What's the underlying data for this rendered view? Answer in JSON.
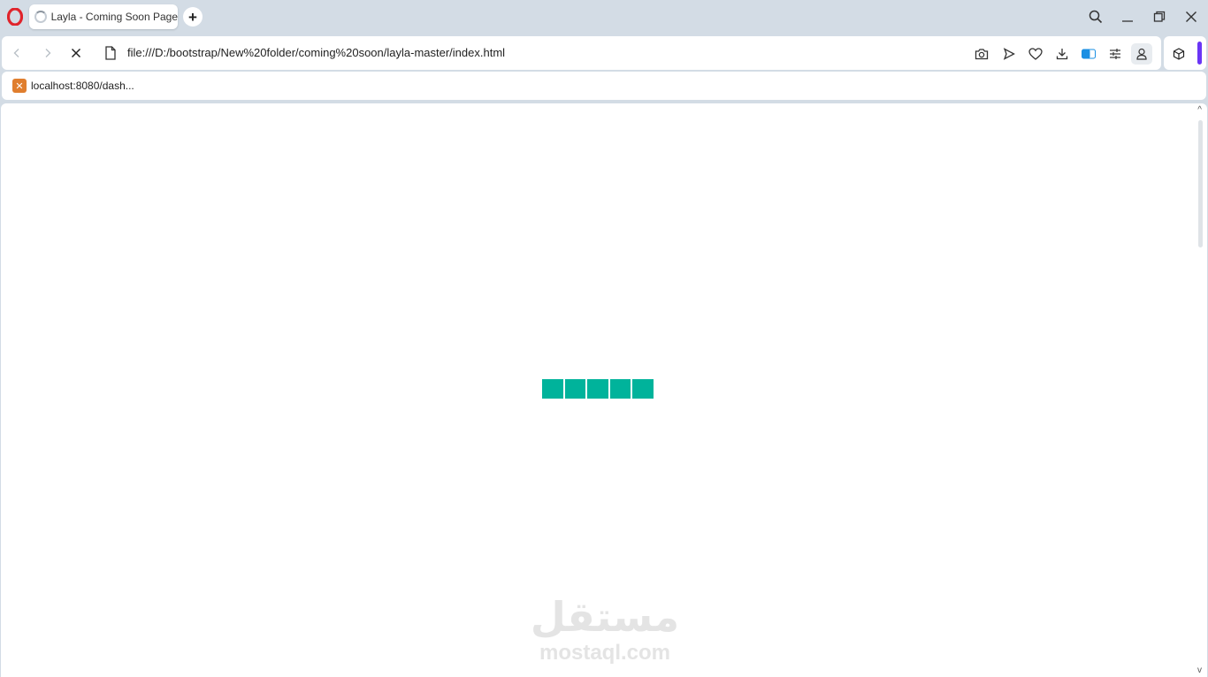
{
  "browser": {
    "tab_title": "Layla - Coming Soon Page",
    "new_tab_symbol": "+",
    "url": "file:///D:/bootstrap/New%20folder/coming%20soon/layla-master/index.html"
  },
  "bookmarks": [
    {
      "label": "localhost:8080/dash...",
      "icon": "xampp-icon"
    }
  ],
  "page": {
    "loader": {
      "blocks": 5,
      "color": "#00b39b"
    },
    "watermark": {
      "arabic": "مستقل",
      "latin": "mostaql.com"
    }
  },
  "colors": {
    "chrome_bg": "#d3dce5",
    "accent": "#00b39b",
    "opera_red": "#e0242b",
    "vpn_blue": "#1a8fe3",
    "sidebar_purple": "#6a35f5"
  }
}
